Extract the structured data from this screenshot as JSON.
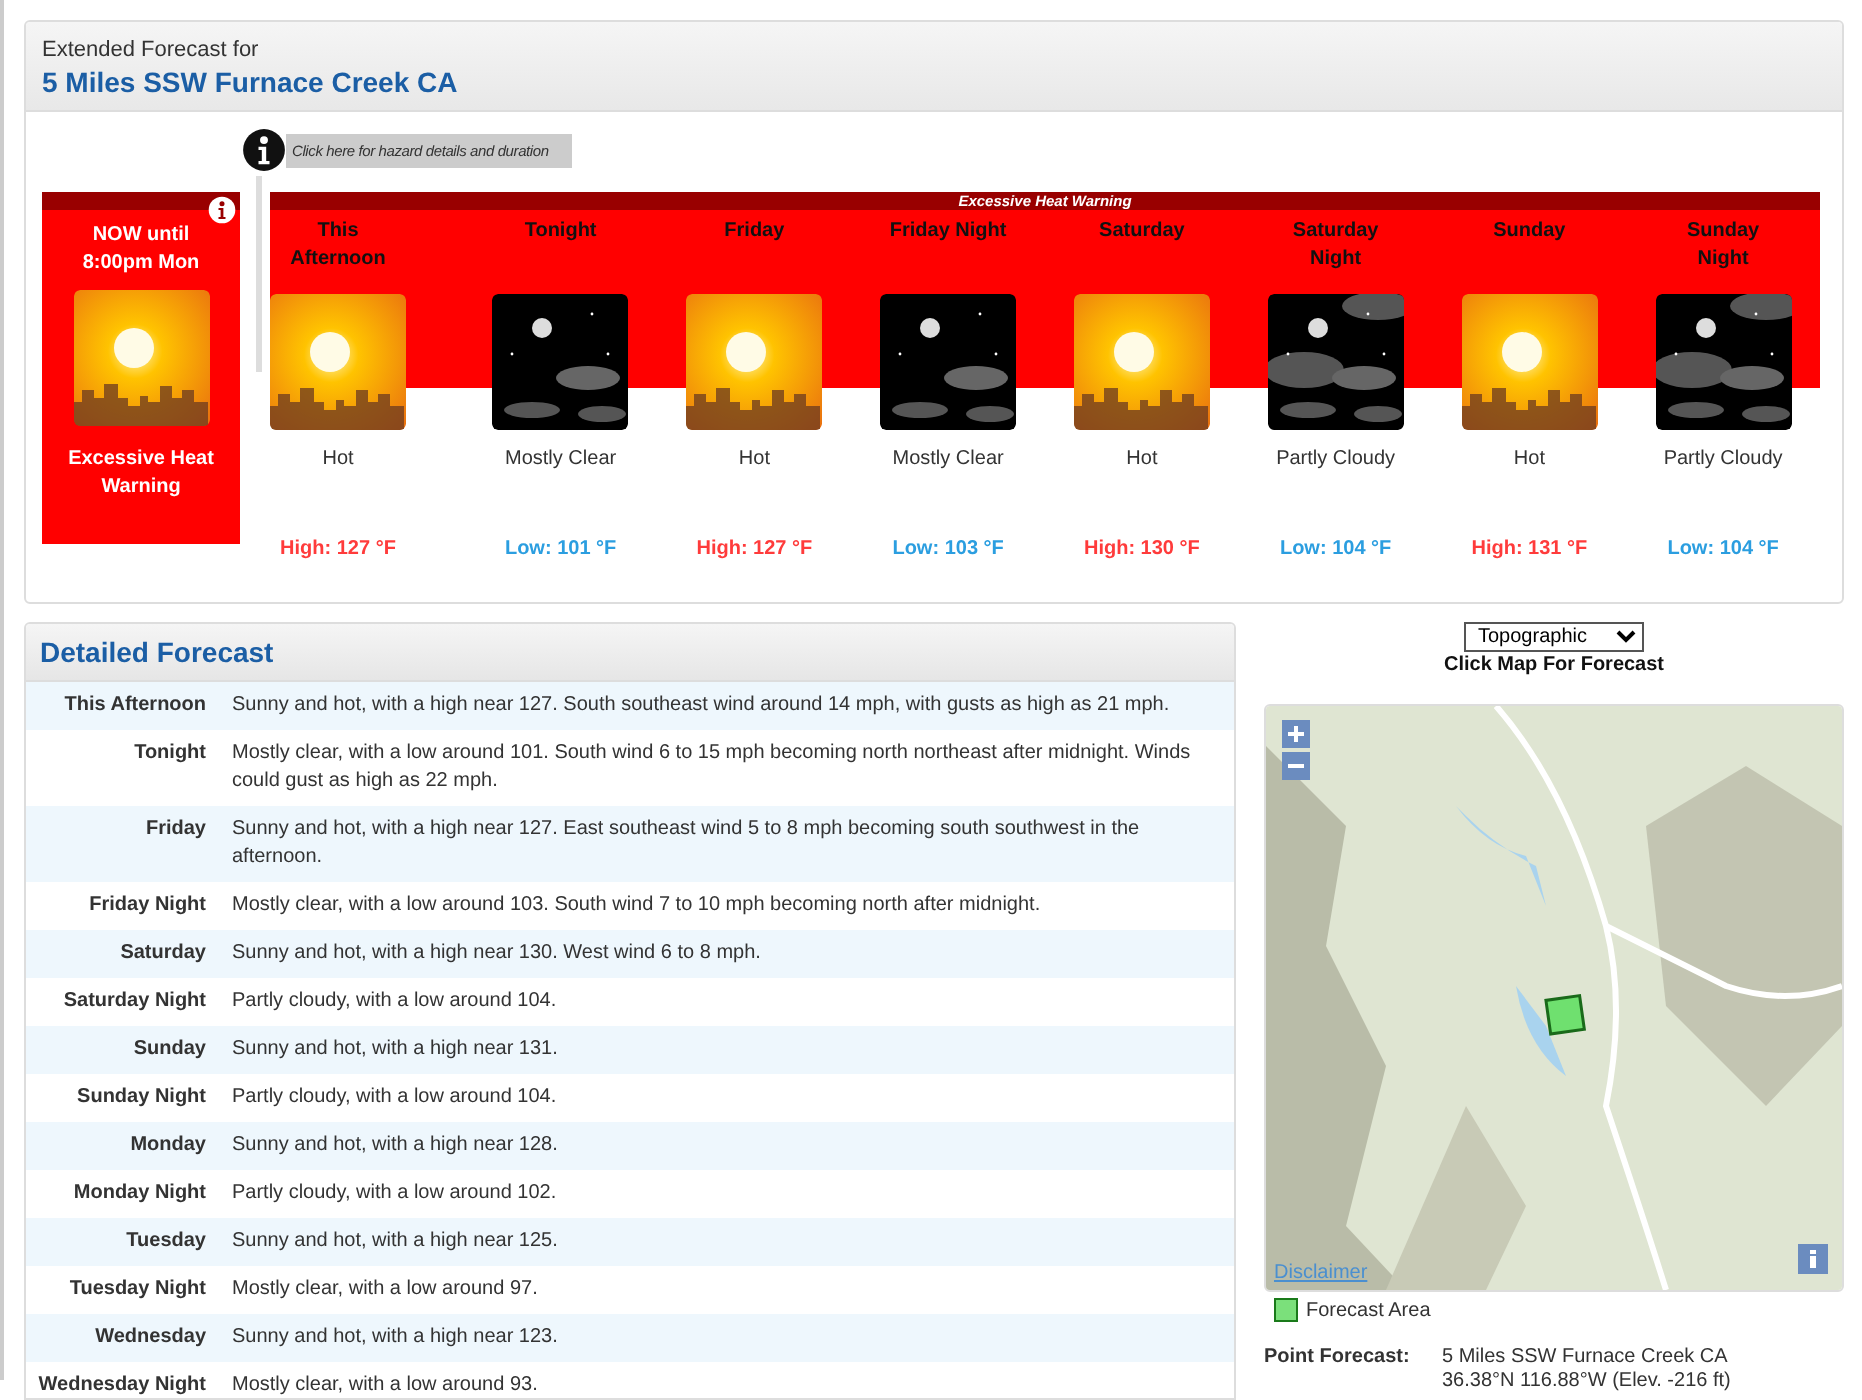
{
  "extended": {
    "caption": "Extended Forecast for",
    "location": "5 Miles SSW Furnace Creek CA"
  },
  "hazard_link": {
    "text": "Click here for hazard details and duration"
  },
  "current_hazard": {
    "time": "NOW until 8:00pm Mon",
    "name": "Excessive Heat Warning"
  },
  "hazard_band": {
    "label": "Excessive Heat Warning"
  },
  "periods": [
    {
      "kind": "hot",
      "name": "This Afternoon",
      "short": "Hot",
      "temp": "High: 127 °F"
    },
    {
      "kind": "clear",
      "name": "Tonight",
      "short": "Mostly Clear",
      "temp": "Low: 101 °F"
    },
    {
      "kind": "hot",
      "name": "Friday",
      "short": "Hot",
      "temp": "High: 127 °F"
    },
    {
      "kind": "clear",
      "name": "Friday Night",
      "short": "Mostly Clear",
      "temp": "Low: 103 °F"
    },
    {
      "kind": "hot",
      "name": "Saturday",
      "short": "Hot",
      "temp": "High: 130 °F"
    },
    {
      "kind": "cloudy",
      "name": "Saturday Night",
      "short": "Partly Cloudy",
      "temp": "Low: 104 °F"
    },
    {
      "kind": "hot",
      "name": "Sunday",
      "short": "Hot",
      "temp": "High: 131 °F"
    },
    {
      "kind": "cloudy",
      "name": "Sunday Night",
      "short": "Partly Cloudy",
      "temp": "Low: 104 °F"
    }
  ],
  "detailed": {
    "title": "Detailed Forecast",
    "rows": [
      {
        "period": "This Afternoon",
        "text": "Sunny and hot, with a high near 127. South southeast wind around 14 mph, with gusts as high as 21 mph."
      },
      {
        "period": "Tonight",
        "text": "Mostly clear, with a low around 101. South wind 6 to 15 mph becoming north northeast after midnight. Winds could gust as high as 22 mph."
      },
      {
        "period": "Friday",
        "text": "Sunny and hot, with a high near 127. East southeast wind 5 to 8 mph becoming south southwest in the afternoon."
      },
      {
        "period": "Friday Night",
        "text": "Mostly clear, with a low around 103. South wind 7 to 10 mph becoming north after midnight."
      },
      {
        "period": "Saturday",
        "text": "Sunny and hot, with a high near 130. West wind 6 to 8 mph."
      },
      {
        "period": "Saturday Night",
        "text": "Partly cloudy, with a low around 104."
      },
      {
        "period": "Sunday",
        "text": "Sunny and hot, with a high near 131."
      },
      {
        "period": "Sunday Night",
        "text": "Partly cloudy, with a low around 104."
      },
      {
        "period": "Monday",
        "text": "Sunny and hot, with a high near 128."
      },
      {
        "period": "Monday Night",
        "text": "Partly cloudy, with a low around 102."
      },
      {
        "period": "Tuesday",
        "text": "Sunny and hot, with a high near 125."
      },
      {
        "period": "Tuesday Night",
        "text": "Mostly clear, with a low around 97."
      },
      {
        "period": "Wednesday",
        "text": "Sunny and hot, with a high near 123."
      },
      {
        "period": "Wednesday Night",
        "text": "Mostly clear, with a low around 93."
      }
    ]
  },
  "map": {
    "layer": "Topographic",
    "instruction": "Click Map For Forecast",
    "disclaimer": "Disclaimer",
    "legend": "Forecast Area"
  },
  "point_forecast": {
    "label": "Point Forecast:",
    "place": "5 Miles SSW Furnace Creek CA",
    "coords": "36.38°N 116.88°W (Elev. -216 ft)"
  }
}
